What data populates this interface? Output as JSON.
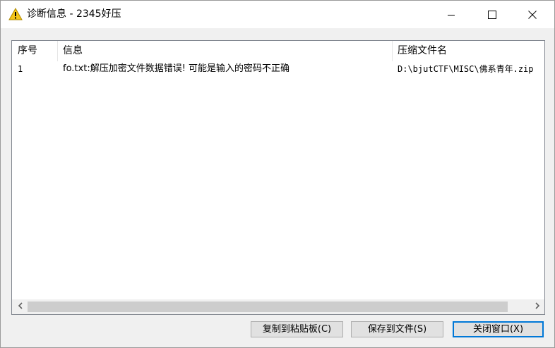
{
  "window": {
    "title": "诊断信息 - 2345好压",
    "icon": "warning-icon"
  },
  "titlebar_buttons": {
    "minimize": "minimize-icon",
    "maximize": "maximize-icon",
    "close": "close-icon"
  },
  "list": {
    "columns": [
      "序号",
      "信息",
      "压缩文件名"
    ],
    "rows": [
      {
        "index": "1",
        "message": "fo.txt:解压加密文件数据错误!  可能是输入的密码不正确",
        "archive": "D:\\bjutCTF\\MISC\\佛系青年.zip"
      }
    ]
  },
  "buttons": {
    "copy": "复制到粘贴板(C)",
    "save": "保存到文件(S)",
    "close": "关闭窗口(X)"
  },
  "colors": {
    "focus_border": "#0078d7",
    "warning": "#f5c518"
  }
}
